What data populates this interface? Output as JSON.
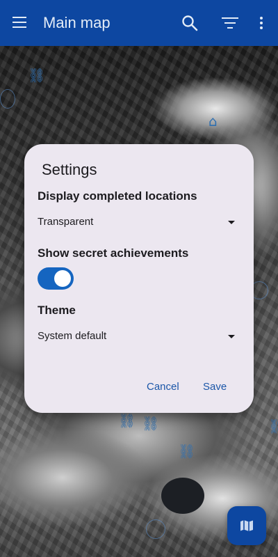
{
  "appbar": {
    "title": "Main map",
    "menu_icon": "menu-icon",
    "search_icon": "search-icon",
    "filter_icon": "filter-icon",
    "more_icon": "more-vert-icon",
    "background": "#0d47a1"
  },
  "dialog": {
    "title": "Settings",
    "completed_label": "Display completed locations",
    "completed_value": "Transparent",
    "secret_label": "Show secret achievements",
    "secret_enabled": true,
    "theme_label": "Theme",
    "theme_value": "System default",
    "cancel_label": "Cancel",
    "save_label": "Save",
    "background": "#ece7f0",
    "accent": "#1565c0"
  },
  "fab": {
    "icon": "map-icon"
  }
}
